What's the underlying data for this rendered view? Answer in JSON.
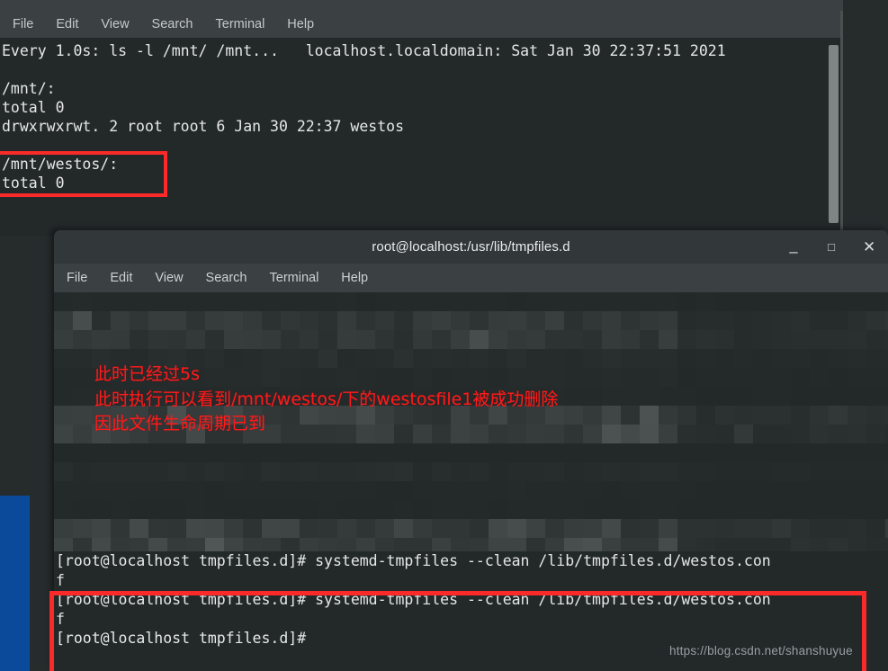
{
  "desktop": {
    "background_color": "#262b2c",
    "accent_strip_color": "#0b4a9b"
  },
  "annotation_color": "#ff1a1a",
  "window_back": {
    "name": "watch-terminal",
    "partial_title": "",
    "menu": [
      "File",
      "Edit",
      "View",
      "Search",
      "Terminal",
      "Help"
    ],
    "terminal_text": "Every 1.0s: ls -l /mnt/ /mnt...   localhost.localdomain: Sat Jan 30 22:37:51 2021\n\n/mnt/:\ntotal 0\ndrwxrwxrwt. 2 root root 6 Jan 30 22:37 westos\n\n/mnt/westos/:\ntotal 0",
    "watch_header": {
      "interval": "Every 1.0s:",
      "command": "ls -l /mnt/ /mnt...",
      "host": "localhost.localdomain:",
      "timestamp": "Sat Jan 30 22:37:51 2021"
    },
    "listing": {
      "dir1_label": "/mnt/:",
      "dir1_total": "total 0",
      "dir1_entry": "drwxrwxrwt. 2 root root 6 Jan 30 22:37 westos",
      "dir2_label": "/mnt/westos/:",
      "dir2_total": "total 0"
    },
    "highlight_box_1_note": "red box around /mnt/westos/: and total 0"
  },
  "window_front": {
    "name": "tmpfiles-terminal",
    "title": "root@localhost:/usr/lib/tmpfiles.d",
    "menu": [
      "File",
      "Edit",
      "View",
      "Search",
      "Terminal",
      "Help"
    ],
    "window_buttons": {
      "minimize": "–",
      "maximize": "□",
      "close": "✕"
    },
    "censored_region_note": "pixelated / mosaic-obscured scrollback",
    "annotation_lines": [
      "此时已经过5s",
      "此时执行可以看到/mnt/westos/下的westosfile1被成功删除",
      "因此文件生命周期已到"
    ],
    "prompt_lines": [
      "[root@localhost tmpfiles.d]# systemd-tmpfiles --clean /lib/tmpfiles.d/westos.con",
      "f",
      "[root@localhost tmpfiles.d]# systemd-tmpfiles --clean /lib/tmpfiles.d/westos.con",
      "f",
      "[root@localhost tmpfiles.d]#"
    ],
    "prompt_text": "[root@localhost tmpfiles.d]# systemd-tmpfiles --clean /lib/tmpfiles.d/westos.con\nf\n[root@localhost tmpfiles.d]# systemd-tmpfiles --clean /lib/tmpfiles.d/westos.con\nf\n[root@localhost tmpfiles.d]#",
    "highlight_box_2_note": "red box around last two command invocations and final prompt"
  },
  "watermark": "https://blog.csdn.net/shanshuyue"
}
